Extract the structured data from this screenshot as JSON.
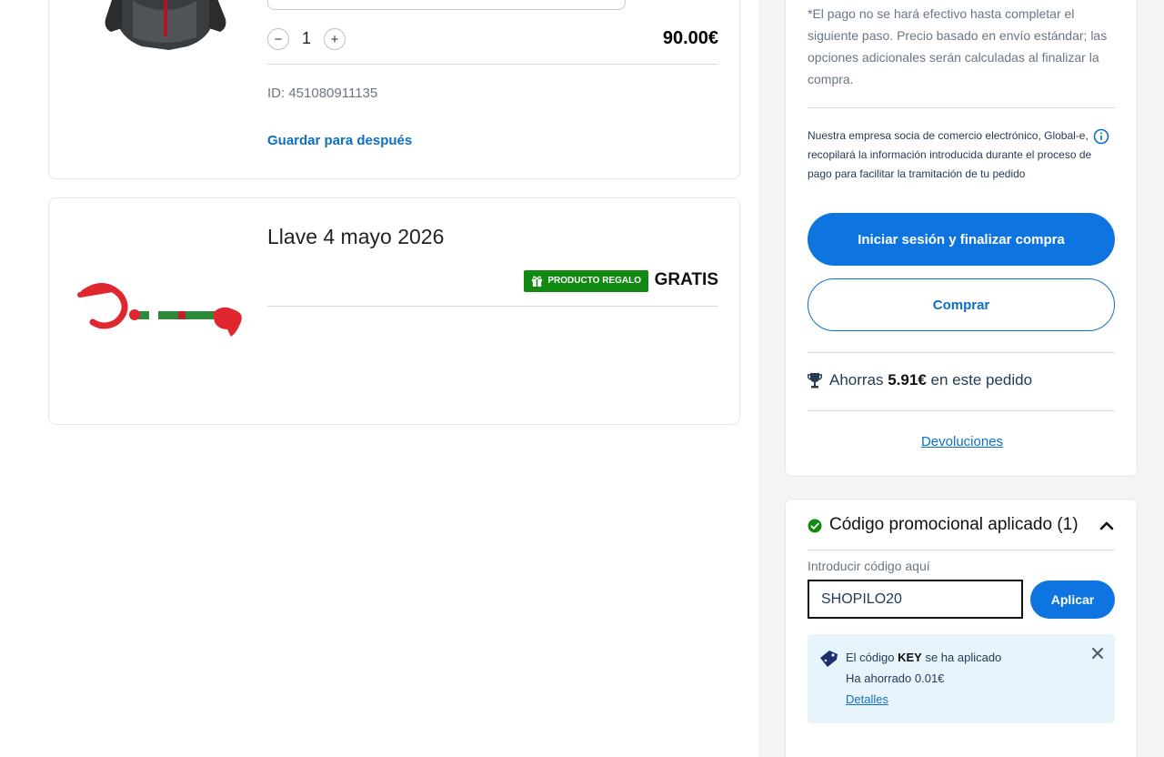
{
  "cart": {
    "item1": {
      "quantity": "1",
      "minus": "−",
      "plus": "+",
      "price": "90.00€",
      "id_text": "ID: 451080911135",
      "save_for_later": "Guardar para después"
    },
    "item2": {
      "title": "Llave 4  mayo 2026",
      "gift_badge": "PRODUCTO REGALO",
      "price": "GRATIS"
    }
  },
  "summary": {
    "note": "*El pago no se hará efectivo hasta completar el siguiente paso. Precio basado en envío estándar; las opciones adicionales serán calculadas al finalizar la compra.",
    "globale": "Nuestra empresa socia de comercio electrónico, Global-e, recopilará la información introducida durante el proceso de pago para facilitar la tramitación de tu pedido",
    "login_checkout": "Iniciar sesión y finalizar compra",
    "buy": "Comprar",
    "savings_prefix": "Ahorras ",
    "savings_amount": "5.91€",
    "savings_suffix": " en este pedido",
    "returns": "Devoluciones"
  },
  "promo": {
    "title": "Código promocional aplicado (1)",
    "label": "Introducir código aquí",
    "input_value": "SHOPILO20",
    "apply": "Aplicar",
    "applied_prefix": "El código ",
    "applied_code": "KEY",
    "applied_suffix": " se ha aplicado",
    "saved": "Ha ahorrado 0.01€",
    "details": "Detalles"
  },
  "colors": {
    "primary": "#0d74e0",
    "success": "#128a12",
    "text": "#253b56"
  }
}
